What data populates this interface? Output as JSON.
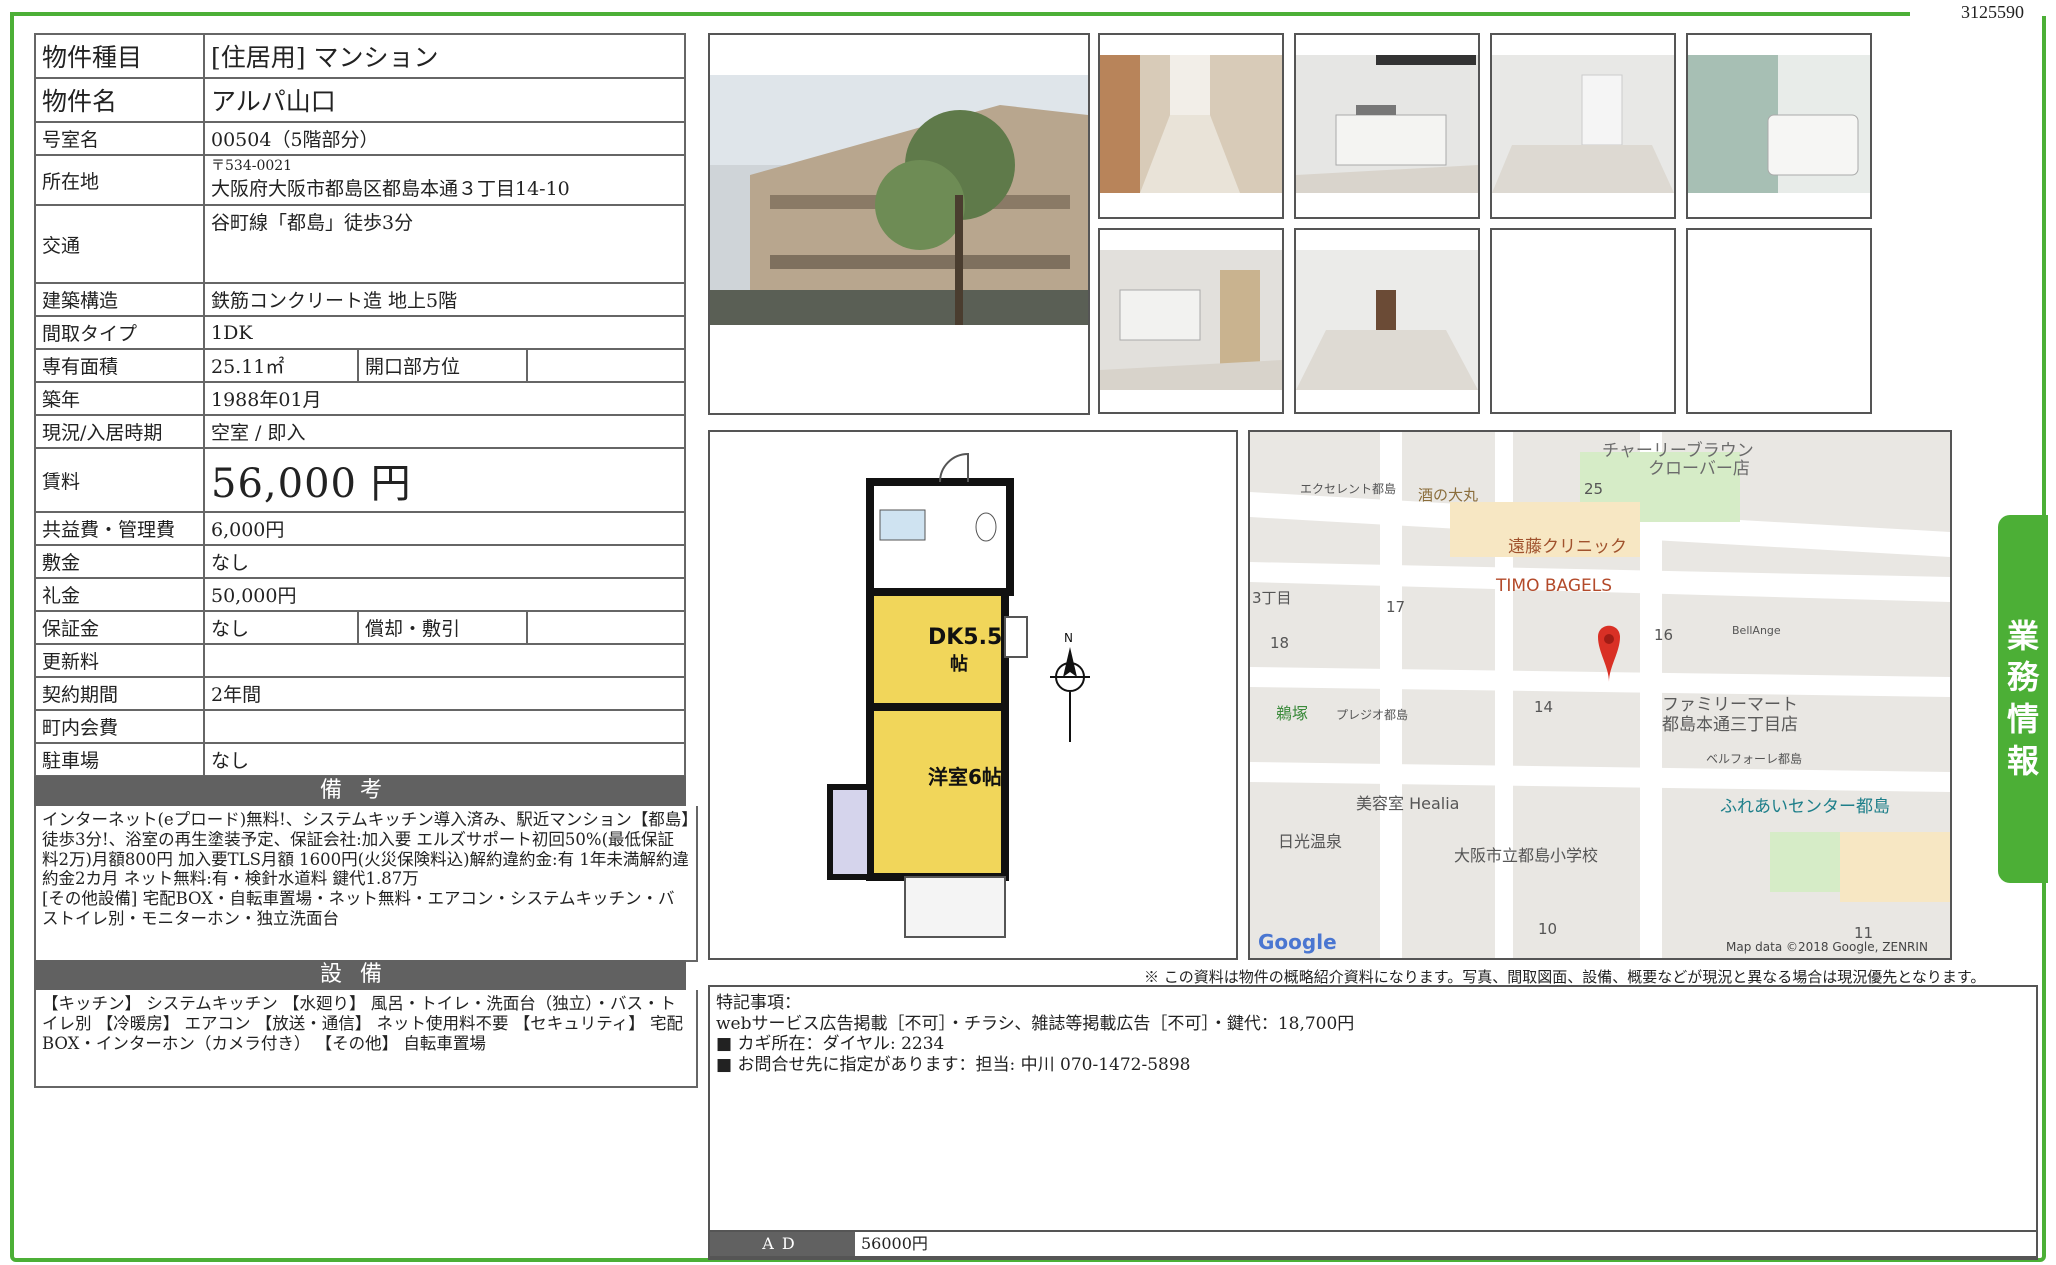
{
  "doc_id": "3125590",
  "side_tab": [
    "業",
    "務",
    "情",
    "報"
  ],
  "property": {
    "type_label": "物件種目",
    "type_value": "[住居用] マンション",
    "name_label": "物件名",
    "name_value": "アルパ山口",
    "room_label": "号室名",
    "room_value": "00504（5階部分）",
    "address_label": "所在地",
    "address_zip": "〒534-0021",
    "address_value": "大阪府大阪市都島区都島本通３丁目14-10",
    "access_label": "交通",
    "access_value": "谷町線「都島」徒歩3分",
    "structure_label": "建築構造",
    "structure_value": "鉄筋コンクリート造 地上5階",
    "layout_label": "間取タイプ",
    "layout_value": "1DK",
    "area_label": "専有面積",
    "area_value": "25.11㎡",
    "facing_label": "開口部方位",
    "facing_value": "",
    "built_label": "築年",
    "built_value": "1988年01月",
    "status_label": "現況/入居時期",
    "status_value": "空室 / 即入",
    "rent_label": "賃料",
    "rent_value": "56,000 円",
    "fee_label": "共益費・管理費",
    "fee_value": "6,000円",
    "deposit_label": "敷金",
    "deposit_value": "なし",
    "key_money_label": "礼金",
    "key_money_value": "50,000円",
    "guarantee_label": "保証金",
    "guarantee_value": "なし",
    "amort_label": "償却・敷引",
    "amort_value": "",
    "renewal_label": "更新料",
    "renewal_value": "",
    "term_label": "契約期間",
    "term_value": "2年間",
    "community_label": "町内会費",
    "community_value": "",
    "parking_label": "駐車場",
    "parking_value": "なし"
  },
  "notes": {
    "heading": "備考",
    "text": "インターネット(eプロード)無料!、システムキッチン導入済み、駅近マンション【都島】徒歩3分!、浴室の再生塗装予定、保証会社:加入要 エルズサポート初回50%(最低保証料2万)月額800円 加入要TLS月額 1600円(火災保険料込)解約違約金:有 1年未満解約違約金2カ月 ネット無料:有・検針水道料 鍵代1.87万\n[その他設備] 宅配BOX・自転車置場・ネット無料・エアコン・システムキッチン・バストイレ別・モニターホン・独立洗面台"
  },
  "facilities": {
    "heading": "設備",
    "text": "【キッチン】 システムキッチン 【水廻り】 風呂・トイレ・洗面台（独立）・バス・トイレ別 【冷暖房】 エアコン 【放送・通信】 ネット使用料不要 【セキュリティ】 宅配BOX・インターホン（カメラ付き） 【その他】 自転車置場"
  },
  "floorplan": {
    "dk": "DK5.5",
    "dk_unit": "帖",
    "room": "洋室6帖",
    "north": "N"
  },
  "map": {
    "labels": [
      "チャーリーブラウン",
      "クローバー店",
      "エクセレント都島",
      "酒の大丸",
      "25",
      "遠藤クリニック",
      "TIMO BAGELS",
      "3丁目",
      "17",
      "BellAnge",
      "18",
      "16",
      "ファミリーマート",
      "都島本通三丁目店",
      "鵜塚",
      "プレジオ都島",
      "14",
      "ベルフォーレ都島",
      "美容室 Healia",
      "ふれあいセンター都島",
      "日光温泉",
      "大阪市立都島小学校",
      "10",
      "11",
      "Google",
      "Map data ©2018 Google, ZENRIN"
    ]
  },
  "notice": "※ この資料は物件の概略紹介資料になります。写真、間取図面、設備、概要などが現況と異なる場合は現況優先となります。",
  "remarks": {
    "title": "特記事項：",
    "line1": "webサービス広告掲載［不可］・チラシ、雑誌等掲載広告［不可］・鍵代：18,700円",
    "line2": "■ カギ所在：ダイヤル: 2234",
    "line3": "■ お問合せ先に指定があります：担当: 中川 070-1472-5898"
  },
  "ad": {
    "label": "AD",
    "value": "56000円"
  }
}
